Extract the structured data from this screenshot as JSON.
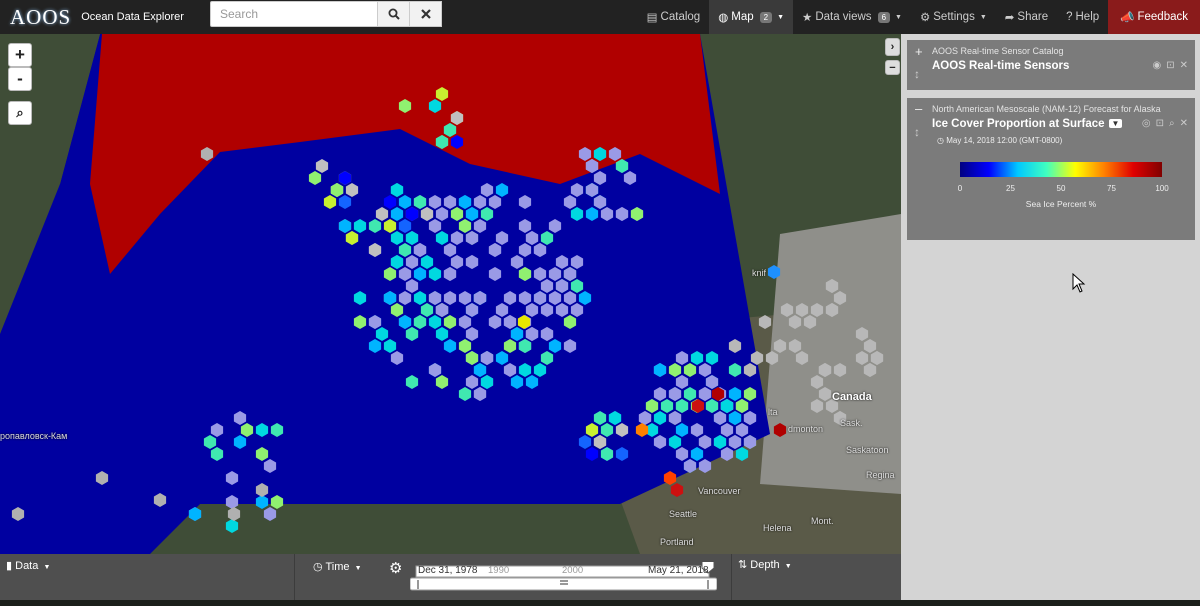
{
  "app": {
    "logo": "AOOS",
    "name": "Ocean Data Explorer"
  },
  "search": {
    "placeholder": "Search",
    "search_icon": "search-icon",
    "clear_icon": "close-icon"
  },
  "nav": {
    "catalog": "Catalog",
    "map": "Map",
    "map_badge": "2",
    "data_views": "Data views",
    "data_views_badge": "6",
    "settings": "Settings",
    "share": "Share",
    "help": "Help",
    "feedback": "Feedback"
  },
  "map": {
    "zoom_in": "+",
    "zoom_out": "-",
    "colors": {
      "ocean": "#0000a0",
      "ice_high": "#b00000",
      "land": "#42503a",
      "mask": "#c4c4c4"
    },
    "labels": {
      "kamchatka": "ропавловск-Кам",
      "canada": "Canada",
      "vancouver": "Vancouver",
      "seattle": "Seattle",
      "portland": "Portland",
      "edmonton": "dmonton",
      "saskatoon": "Saskatoon",
      "regina": "Regina",
      "helena": "Helena",
      "yellowknife": "knif",
      "sask": "Sask.",
      "alta": "lta",
      "mont": "Mont."
    }
  },
  "layers": [
    {
      "source": "AOOS Real-time Sensor Catalog",
      "title": "AOOS Real-time Sensors",
      "toggle": "+"
    },
    {
      "source": "North American Mesoscale (NAM-12) Forecast for Alaska",
      "title": "Ice Cover Proportion at Surface",
      "toggle": "–",
      "timestamp": "May 14, 2018 12:00 (GMT-0800)",
      "legend": {
        "ticks": [
          "0",
          "25",
          "50",
          "75",
          "100"
        ],
        "unit": "Sea Ice Percent %"
      }
    }
  ],
  "bottom": {
    "data_label": "Data",
    "time_label": "Time",
    "start_date": "Dec 31, 1978",
    "end_date": "May 21, 2018",
    "tick_1990": "1990",
    "tick_2000": "2000",
    "depth_label": "Depth"
  }
}
